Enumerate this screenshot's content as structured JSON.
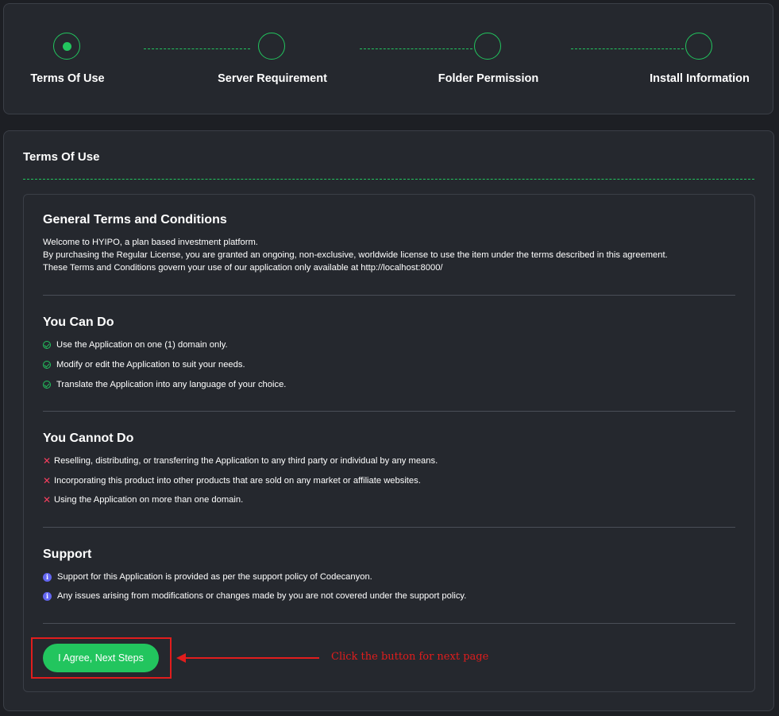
{
  "stepper": {
    "steps": [
      {
        "label": "Terms Of Use",
        "active": true
      },
      {
        "label": "Server Requirement",
        "active": false
      },
      {
        "label": "Folder Permission",
        "active": false
      },
      {
        "label": "Install Information",
        "active": false
      }
    ]
  },
  "main": {
    "title": "Terms Of Use",
    "general": {
      "title": "General Terms and Conditions",
      "lines": [
        "Welcome to HYIPO, a plan based investment platform.",
        "By purchasing the Regular License, you are granted an ongoing, non-exclusive, worldwide license to use the item under the terms described in this agreement.",
        "These Terms and Conditions govern your use of our application only available at http://localhost:8000/"
      ]
    },
    "can_do": {
      "title": "You Can Do",
      "items": [
        "Use the Application on one (1) domain only.",
        "Modify or edit the Application to suit your needs.",
        "Translate the Application into any language of your choice."
      ]
    },
    "cannot_do": {
      "title": "You Cannot Do",
      "items": [
        "Reselling, distributing, or transferring the Application to any third party or individual by any means.",
        "Incorporating this product into other products that are sold on any market or affiliate websites.",
        "Using the Application on more than one domain."
      ]
    },
    "support": {
      "title": "Support",
      "items": [
        "Support for this Application is provided as per the support policy of Codecanyon.",
        "Any issues arising from modifications or changes made by you are not covered under the support policy."
      ]
    },
    "agree_button": "I Agree, Next Steps"
  },
  "annotation": {
    "text": "Click the button for next page",
    "color": "#e11d1d"
  },
  "colors": {
    "accent": "#22c55e",
    "danger": "#f43f5e",
    "info": "#6366f1",
    "background": "#1d1f24",
    "card": "#25282e"
  },
  "icons": {
    "can_do": "check-circle-icon",
    "cannot_do": "x-icon",
    "support": "info-icon"
  }
}
